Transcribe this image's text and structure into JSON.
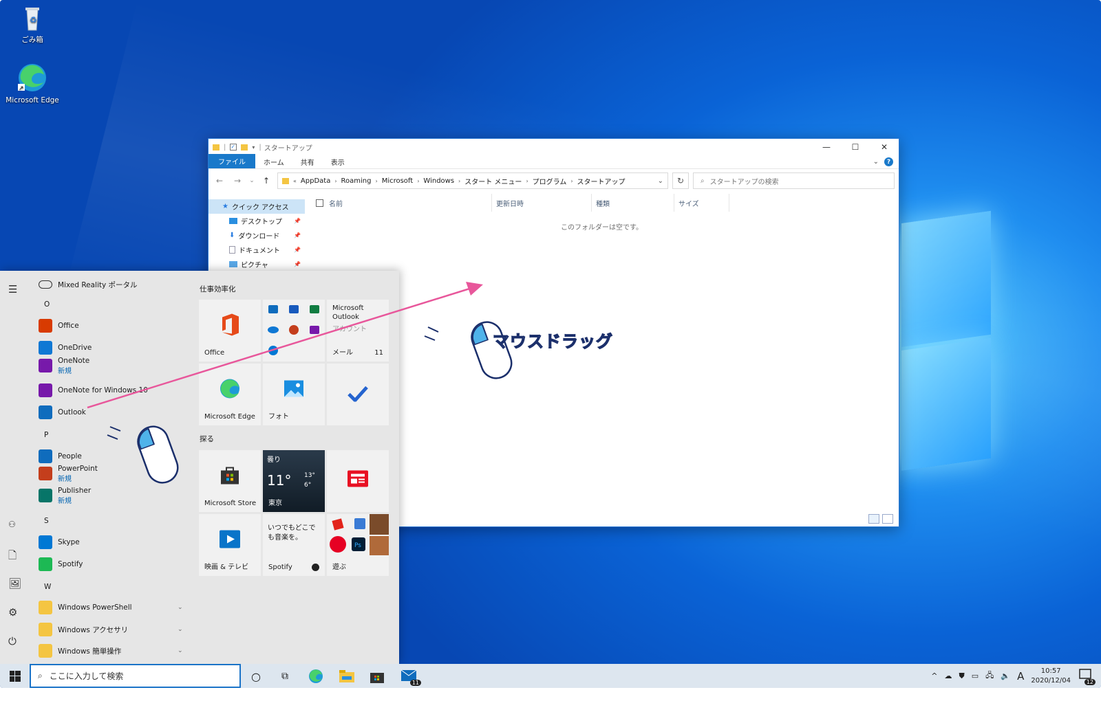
{
  "desktop": {
    "icons": [
      {
        "label": "ごみ箱",
        "icon": "recycle-bin-icon"
      },
      {
        "label": "Microsoft Edge",
        "icon": "edge-icon"
      }
    ]
  },
  "explorer": {
    "title": "スタートアップ",
    "ribbon_tabs": [
      "ファイル",
      "ホーム",
      "共有",
      "表示"
    ],
    "breadcrumbs": [
      "AppData",
      "Roaming",
      "Microsoft",
      "Windows",
      "スタート メニュー",
      "プログラム",
      "スタートアップ"
    ],
    "search_placeholder": "スタートアップの検索",
    "nav": [
      "クイック アクセス",
      "デスクトップ",
      "ダウンロード",
      "ドキュメント",
      "ピクチャ"
    ],
    "columns": [
      "名前",
      "更新日時",
      "種類",
      "サイズ"
    ],
    "empty_text": "このフォルダーは空です。"
  },
  "start": {
    "apps": [
      {
        "label": "Mixed Reality ポータル"
      },
      {
        "letter": "O"
      },
      {
        "label": "Office",
        "color": "#d83b01"
      },
      {
        "label": "OneDrive",
        "color": "#0f78d4"
      },
      {
        "label": "OneNote",
        "sub": "新規",
        "color": "#7719aa"
      },
      {
        "label": "OneNote for Windows 10",
        "color": "#7719aa"
      },
      {
        "label": "Outlook",
        "color": "#0f6cbd"
      },
      {
        "letter": "P"
      },
      {
        "label": "People",
        "color": "#0f6cbd"
      },
      {
        "label": "PowerPoint",
        "sub": "新規",
        "color": "#c43e1c"
      },
      {
        "label": "Publisher",
        "sub": "新規",
        "color": "#077568"
      },
      {
        "letter": "S"
      },
      {
        "label": "Skype",
        "color": "#0078d4"
      },
      {
        "label": "Spotify",
        "color": "#1db954"
      },
      {
        "letter": "W"
      },
      {
        "label": "Windows PowerShell",
        "folder": true
      },
      {
        "label": "Windows アクセサリ",
        "folder": true
      },
      {
        "label": "Windows 簡単操作",
        "folder": true
      }
    ],
    "groups": [
      "仕事効率化",
      "探る"
    ],
    "tiles": {
      "office": "Office",
      "outlook_title": "Microsoft Outlook",
      "outlook_sub": "アカウント",
      "mail": "メール",
      "mail_count": "11",
      "edge": "Microsoft Edge",
      "photos": "フォト",
      "store": "Microsoft Store",
      "weather_cond": "曇り",
      "weather_temp": "11°",
      "weather_hi": "13°",
      "weather_lo": "6°",
      "weather_city": "東京",
      "movies": "映画 & テレビ",
      "spotify_text": "いつでもどこでも音楽を。",
      "spotify": "Spotify",
      "play": "遊ぶ"
    }
  },
  "taskbar": {
    "search_placeholder": "ここに入力して検索",
    "time": "10:57",
    "date": "2020/12/04",
    "ime": "A",
    "mail_badge": "11",
    "notif_badge": "12"
  },
  "annotation": {
    "label": "マウスドラッグ"
  }
}
